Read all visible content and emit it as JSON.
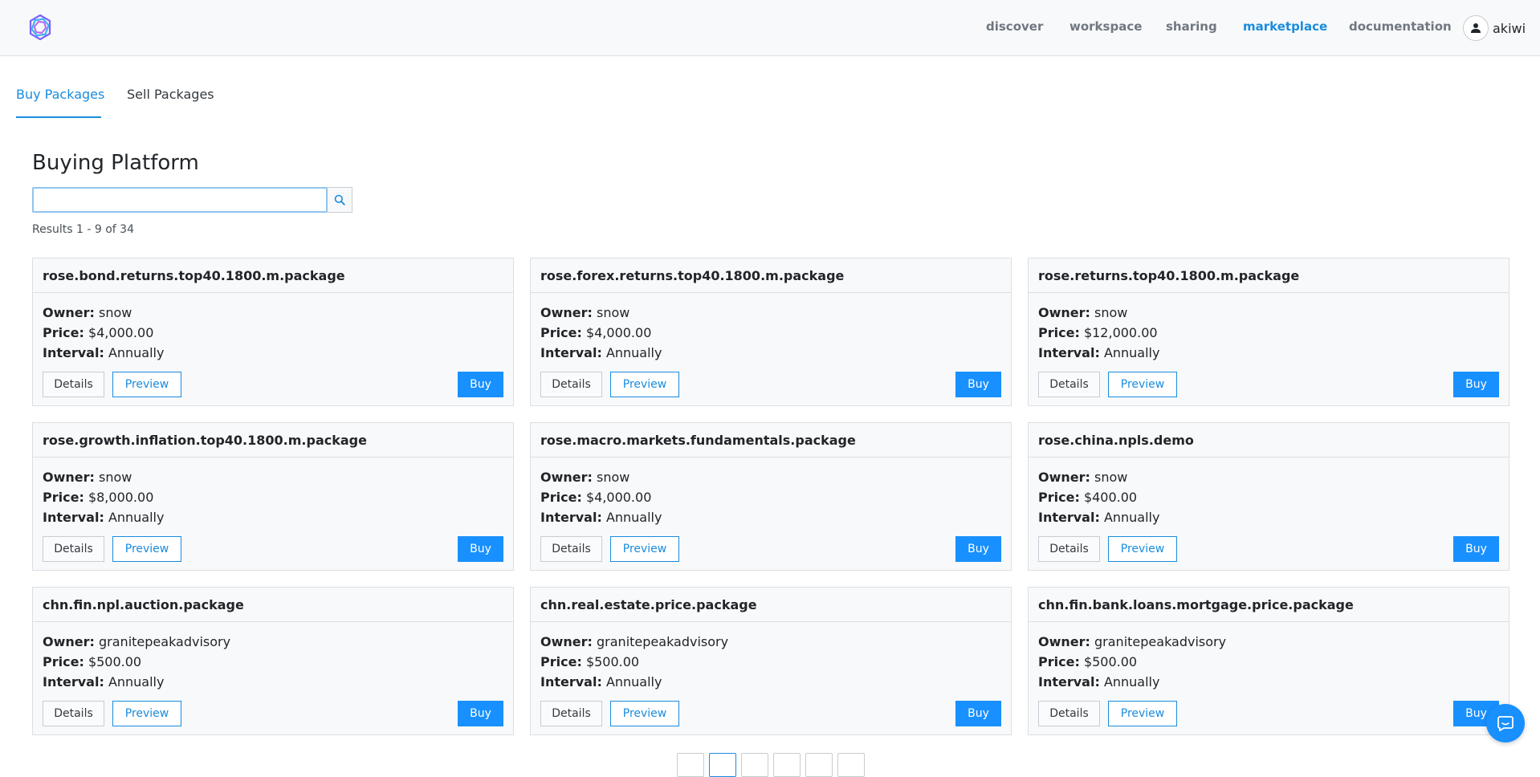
{
  "nav": {
    "links": [
      "discover",
      "workspace",
      "sharing",
      "marketplace",
      "documentation"
    ],
    "active": "marketplace",
    "user_name": "akiwi"
  },
  "tabs": [
    {
      "label": "Buy Packages",
      "active": true
    },
    {
      "label": "Sell Packages",
      "active": false
    }
  ],
  "page_title": "Buying Platform",
  "search": {
    "value": "",
    "placeholder": ""
  },
  "results_text": "Results 1 - 9 of 34",
  "labels": {
    "owner": "Owner:",
    "price": "Price:",
    "interval": "Interval:",
    "details": "Details",
    "preview": "Preview",
    "buy": "Buy"
  },
  "packages": [
    {
      "name": "rose.bond.returns.top40.1800.m.package",
      "owner": "snow",
      "price": "$4,000.00",
      "interval": "Annually"
    },
    {
      "name": "rose.forex.returns.top40.1800.m.package",
      "owner": "snow",
      "price": "$4,000.00",
      "interval": "Annually"
    },
    {
      "name": "rose.returns.top40.1800.m.package",
      "owner": "snow",
      "price": "$12,000.00",
      "interval": "Annually"
    },
    {
      "name": "rose.growth.inflation.top40.1800.m.package",
      "owner": "snow",
      "price": "$8,000.00",
      "interval": "Annually"
    },
    {
      "name": "rose.macro.markets.fundamentals.package",
      "owner": "snow",
      "price": "$4,000.00",
      "interval": "Annually"
    },
    {
      "name": "rose.china.npls.demo",
      "owner": "snow",
      "price": "$400.00",
      "interval": "Annually"
    },
    {
      "name": "chn.fin.npl.auction.package",
      "owner": "granitepeakadvisory",
      "price": "$500.00",
      "interval": "Annually"
    },
    {
      "name": "chn.real.estate.price.package",
      "owner": "granitepeakadvisory",
      "price": "$500.00",
      "interval": "Annually"
    },
    {
      "name": "chn.fin.bank.loans.mortgage.price.package",
      "owner": "granitepeakadvisory",
      "price": "$500.00",
      "interval": "Annually"
    }
  ],
  "colors": {
    "accent": "#1a8cde",
    "buy_button": "#1890ff"
  },
  "icons": {
    "logo": "logo-icon",
    "user": "user-icon",
    "search": "search-icon",
    "chat": "chat-icon"
  }
}
